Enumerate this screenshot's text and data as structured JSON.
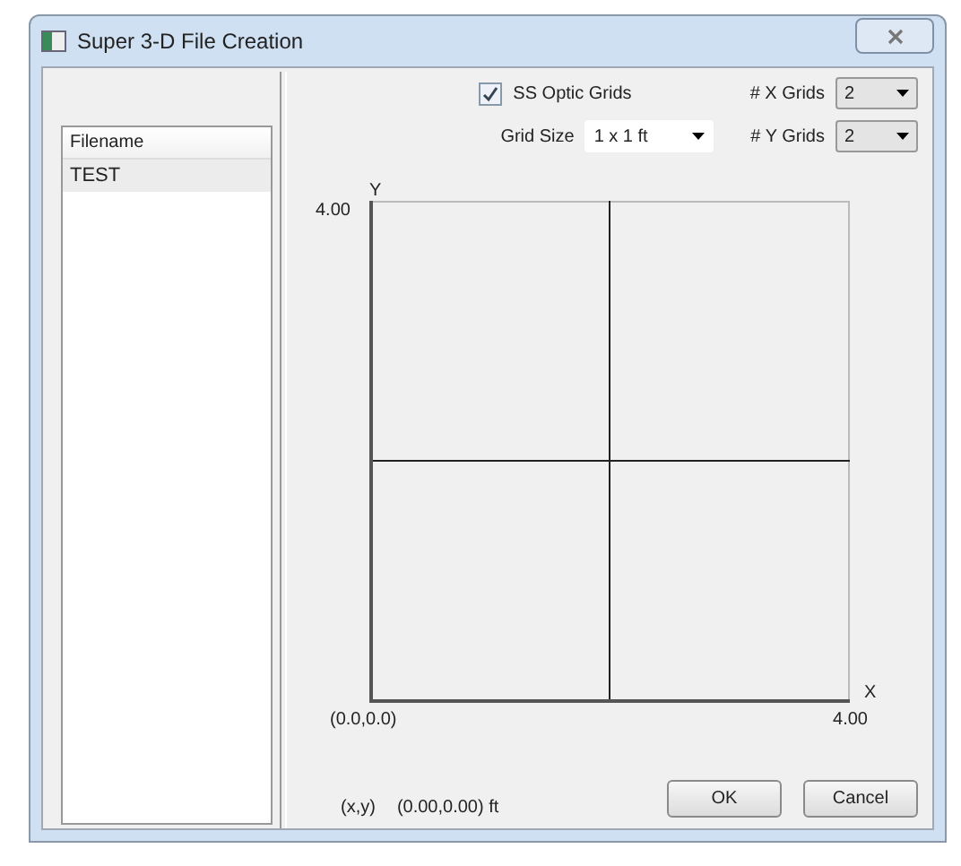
{
  "window": {
    "title": "Super 3-D File Creation"
  },
  "file_list": {
    "column": "Filename",
    "rows": [
      {
        "name": "TEST",
        "selected": true
      }
    ]
  },
  "options": {
    "optic_grids": {
      "label": "SS Optic Grids",
      "checked": true
    },
    "grid_size": {
      "label": "Grid Size",
      "value": "1 x 1 ft"
    },
    "x_grids": {
      "label": "# X Grids",
      "value": "2"
    },
    "y_grids": {
      "label": "# Y Grids",
      "value": "2"
    }
  },
  "plot": {
    "y_axis": "Y",
    "x_axis": "X",
    "y_max": "4.00",
    "origin": "(0.0,0.0)",
    "x_max": "4.00"
  },
  "status": {
    "label": "(x,y)",
    "value": "(0.00,0.00) ft"
  },
  "buttons": [
    "OK",
    "Cancel"
  ]
}
